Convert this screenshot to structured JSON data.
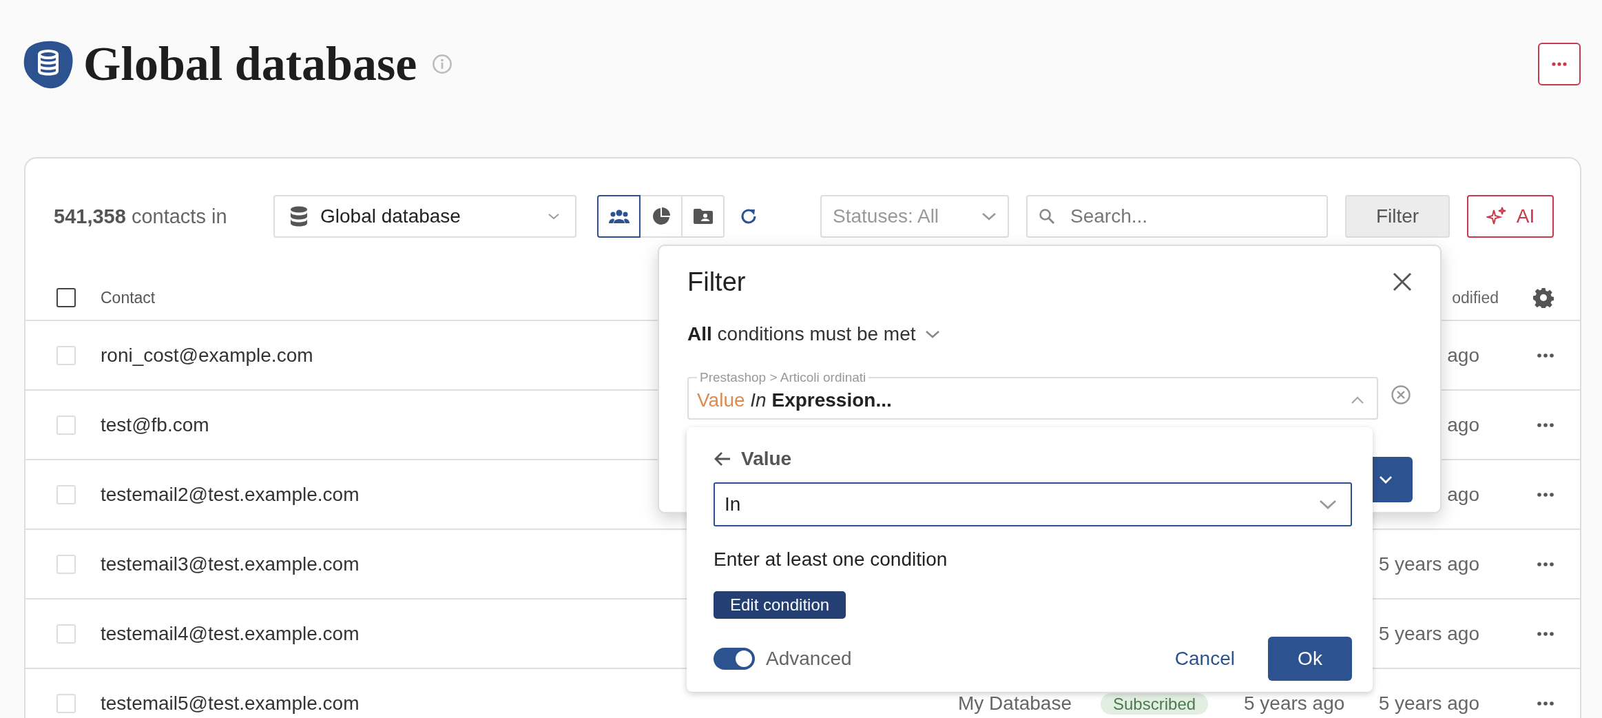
{
  "page_header": {
    "title": "Global database"
  },
  "toolbar": {
    "count": "541,358",
    "count_suffix": "contacts in",
    "database": "Global database",
    "views": [
      {
        "kind": "contacts",
        "selected": true
      },
      {
        "kind": "chart",
        "selected": false
      },
      {
        "kind": "folder",
        "selected": false
      }
    ],
    "statuses": "Statuses: All",
    "search_placeholder": "Search...",
    "filter_button": "Filter",
    "ai_button": "AI"
  },
  "table": {
    "all_selected": false,
    "columns": [
      {
        "kind": "contact",
        "label": "Contact"
      },
      {
        "kind": "modified",
        "label": "odified"
      }
    ],
    "rows": [
      {
        "contact": "roni_cost@example.com",
        "checked": false,
        "modified": "ago"
      },
      {
        "contact": "test@fb.com",
        "checked": false,
        "modified": "ago"
      },
      {
        "contact": "testemail2@test.example.com",
        "checked": false,
        "modified": "ago"
      },
      {
        "contact": "testemail3@test.example.com",
        "checked": false,
        "modified": "5 years ago"
      },
      {
        "contact": "testemail4@test.example.com",
        "checked": false,
        "modified": "5 years ago"
      },
      {
        "contact": "testemail5@test.example.com",
        "checked": false,
        "list": "My Database",
        "status": "Subscribed",
        "created": "5 years ago",
        "modified": "5 years ago"
      }
    ]
  },
  "filter_dialog": {
    "title": "Filter",
    "match_mode": "**All** conditions must be met",
    "condition": {
      "label": "Prestashop > Articoli ordinati",
      "attribute": "Value",
      "operator": "In",
      "expression": "Expression...",
      "expanded": true
    },
    "popup": {
      "back_label": "Value",
      "operator_value": "In",
      "hint": "Enter at least one condition",
      "edit_button": "Edit condition",
      "advanced": {
        "label": "Advanced",
        "on": true
      },
      "cancel_button": "Cancel",
      "ok_button": "Ok"
    }
  }
}
